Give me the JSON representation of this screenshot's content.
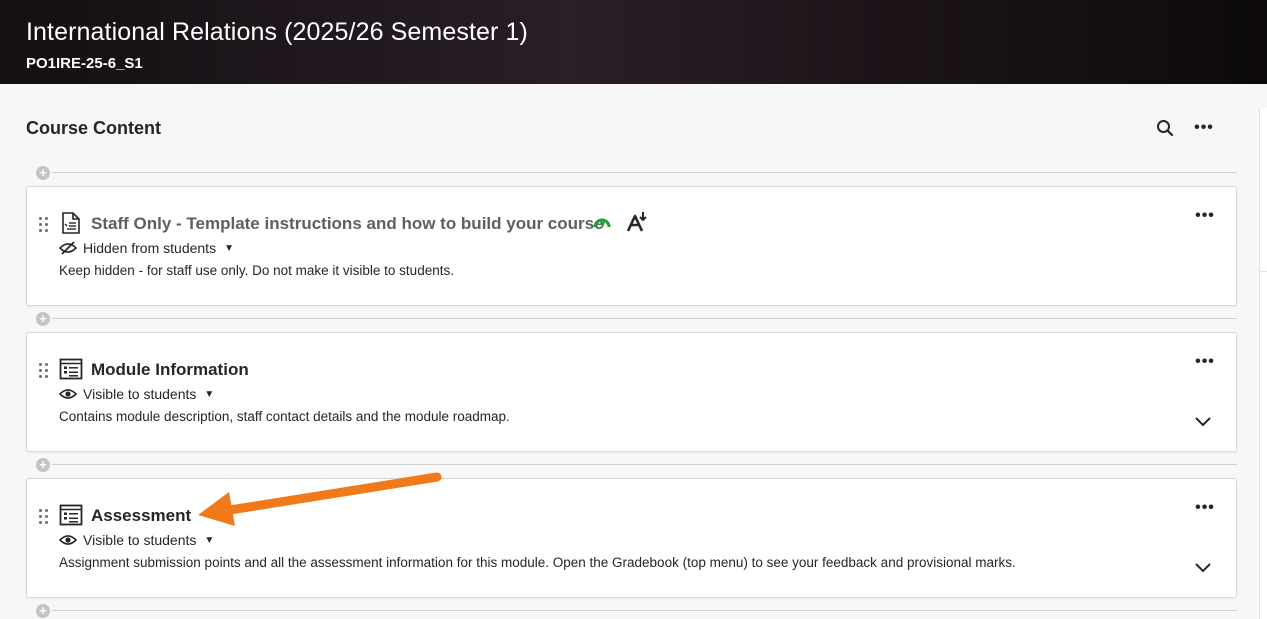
{
  "header": {
    "course_title": "International Relations (2025/26 Semester 1)",
    "course_code": "PO1IRE-25-6_S1"
  },
  "content": {
    "section_title": "Course Content",
    "search_icon": "search-icon",
    "more_icon": "more-options-icon"
  },
  "items": [
    {
      "title": "Staff Only - Template instructions and how to build your course",
      "visibility": "Hidden from students",
      "description": "Keep hidden - for staff use only. Do not make it visible to students.",
      "type_icon": "document-icon",
      "badges": [
        "performance-gauge-icon",
        "accessibility-download-icon"
      ],
      "badge_color": "#1aa030"
    },
    {
      "title": "Module Information",
      "visibility": "Visible to students",
      "description": "Contains module description, staff contact details and the module roadmap.",
      "type_icon": "folder-list-icon"
    },
    {
      "title": "Assessment",
      "visibility": "Visible to students",
      "description": "Assignment submission points and all the assessment information for this module. Open the Gradebook (top menu) to see your feedback and provisional marks.",
      "type_icon": "folder-list-icon"
    }
  ],
  "annotation": {
    "arrow_color": "#f07a1a"
  }
}
